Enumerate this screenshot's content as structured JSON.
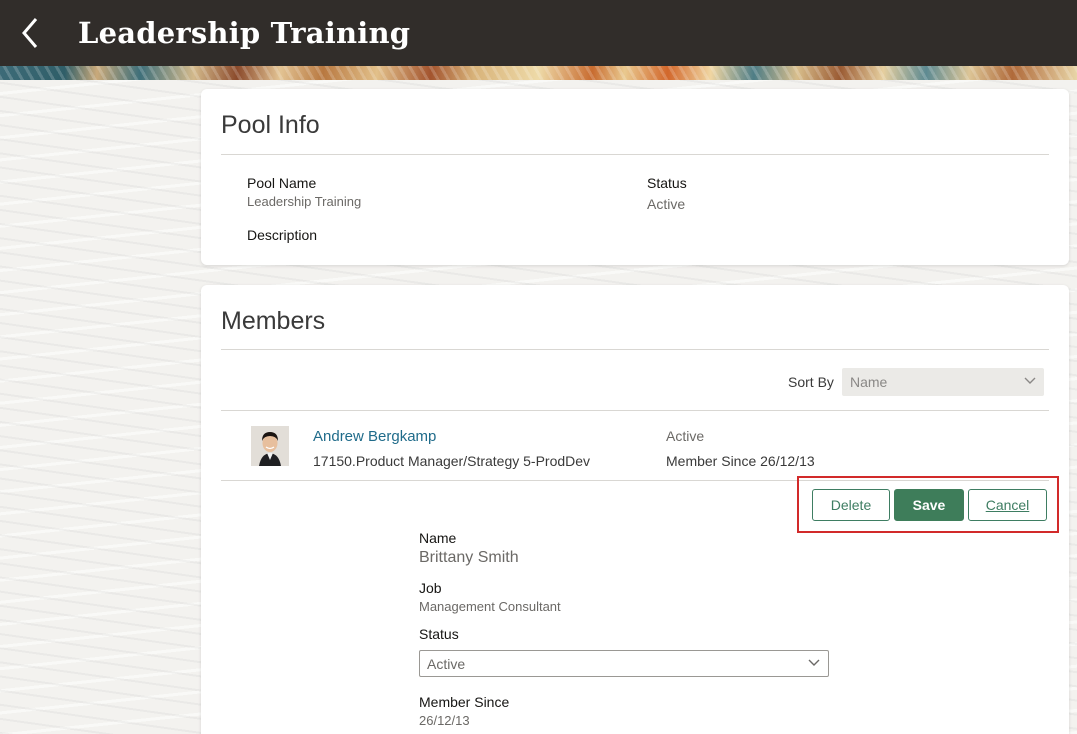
{
  "header": {
    "title": "Leadership Training"
  },
  "pool_info": {
    "section_title": "Pool Info",
    "pool_name_label": "Pool Name",
    "pool_name_value": "Leadership Training",
    "status_label": "Status",
    "status_value": "Active",
    "description_label": "Description"
  },
  "members": {
    "section_title": "Members",
    "sort_by_label": "Sort By",
    "sort_by_value": "Name",
    "list": [
      {
        "name": "Andrew Bergkamp",
        "job": "17150.Product Manager/Strategy 5-ProdDev",
        "status": "Active",
        "member_since": "Member Since 26/12/13"
      }
    ],
    "actions": {
      "delete_label": "Delete",
      "save_label": "Save",
      "cancel_label": "Cancel"
    },
    "detail": {
      "name_label": "Name",
      "name_value": "Brittany Smith",
      "job_label": "Job",
      "job_value": "Management Consultant",
      "status_label": "Status",
      "status_value": "Active",
      "member_since_label": "Member Since",
      "member_since_value": "26/12/13"
    }
  },
  "colors": {
    "header_bg": "#312d2a",
    "link": "#1f6b8a",
    "primary_button": "#3e7d5a",
    "highlight_border": "#d22a2a"
  },
  "icons": {
    "back": "chevron-left-icon",
    "dropdown": "chevron-down-icon"
  }
}
